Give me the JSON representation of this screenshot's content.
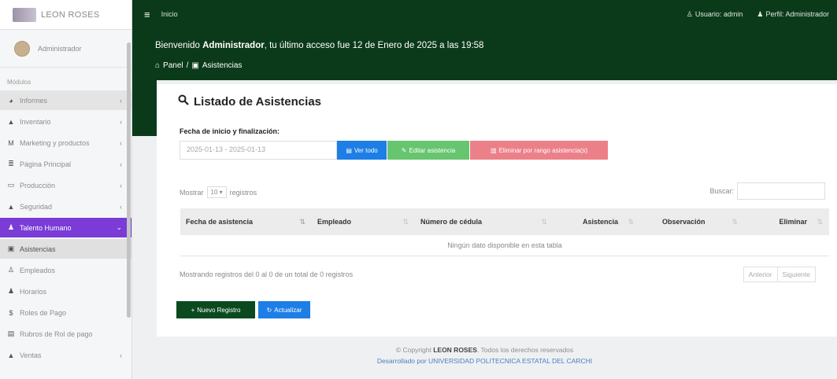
{
  "sidebar": {
    "brand": "LEON ROSES",
    "user": "Administrador",
    "header": "Módulos",
    "items": [
      {
        "label": "Informes",
        "icon": "pie-chart-icon",
        "glyph": "◕",
        "caret": "‹"
      },
      {
        "label": "Inventario",
        "icon": "boxes-icon",
        "glyph": "▲",
        "caret": "‹"
      },
      {
        "label": "Marketing y productos",
        "icon": "tag-icon",
        "glyph": "M",
        "caret": "‹"
      },
      {
        "label": "Página Principal",
        "icon": "bars-icon",
        "glyph": "≣",
        "caret": "‹"
      },
      {
        "label": "Producción",
        "icon": "calendar-icon",
        "glyph": "▭",
        "caret": "‹"
      },
      {
        "label": "Seguridad",
        "icon": "lock-icon",
        "glyph": "▲",
        "caret": "‹"
      },
      {
        "label": "Talento Humano",
        "icon": "users-icon",
        "glyph": "♟",
        "caret": "⌄"
      },
      {
        "label": "Asistencias",
        "icon": "calendar-check-icon",
        "glyph": "▣",
        "caret": ""
      },
      {
        "label": "Empleados",
        "icon": "user-icon",
        "glyph": "♙",
        "caret": ""
      },
      {
        "label": "Horarios",
        "icon": "user-clock-icon",
        "glyph": "♟",
        "caret": ""
      },
      {
        "label": "Roles de Pago",
        "icon": "dollar-icon",
        "glyph": "$",
        "caret": ""
      },
      {
        "label": "Rubros de Rol de pago",
        "icon": "file-invoice-icon",
        "glyph": "▤",
        "caret": ""
      },
      {
        "label": "Ventas",
        "icon": "shopping-icon",
        "glyph": "▲",
        "caret": "‹"
      }
    ]
  },
  "topnav": {
    "home": "Inicio",
    "user_link": "Usuario: admin",
    "profile_link": "Perfil: Administrador"
  },
  "header": {
    "welcome_prefix": "Bienvenido ",
    "welcome_name": "Administrador",
    "welcome_suffix": ", tu último acceso fue 12 de Enero de 2025 a las 19:58",
    "breadcrumb_home": "Panel",
    "breadcrumb_sep": "/",
    "breadcrumb_current": "Asistencias"
  },
  "card": {
    "title": "Listado de Asistencias",
    "date_label": "Fecha de inicio y finalización:",
    "date_value": "2025-01-13 - 2025-01-13",
    "btn_ver": "Ver todo",
    "btn_edit": "Editar asistencia",
    "btn_delete": "Eliminar por rango asistencia(s)",
    "show_prefix": "Mostrar",
    "show_value": "10 ▾",
    "show_suffix": "registros",
    "search_label": "Buscar:",
    "columns": [
      "Fecha de asistencia",
      "Empleado",
      "Número de cédula",
      "Asistencia",
      "Observación",
      "Eliminar"
    ],
    "empty_message": "Ningún dato disponible en esta tabla",
    "info": "Mostrando registros del 0 al 0 de un total de 0 registros",
    "prev": "Anterior",
    "next": "Siguiente",
    "btn_new": "Nuevo Registro",
    "btn_refresh": "Actualizar"
  },
  "footer": {
    "line1_prefix": "© Copyright ",
    "line1_brand": "LEON ROSES",
    "line1_suffix": ". Todos los derechos reservados",
    "line2": "Desarrollado por UNIVERSIDAD POLITECNICA ESTATAL DEL CARCHI"
  },
  "colors": {
    "primary_green": "#0b3a1a",
    "sidebar_active": "#7a3bd6",
    "btn_blue": "#1d7ee6",
    "btn_green": "#67c56f",
    "btn_red": "#ec8089"
  }
}
